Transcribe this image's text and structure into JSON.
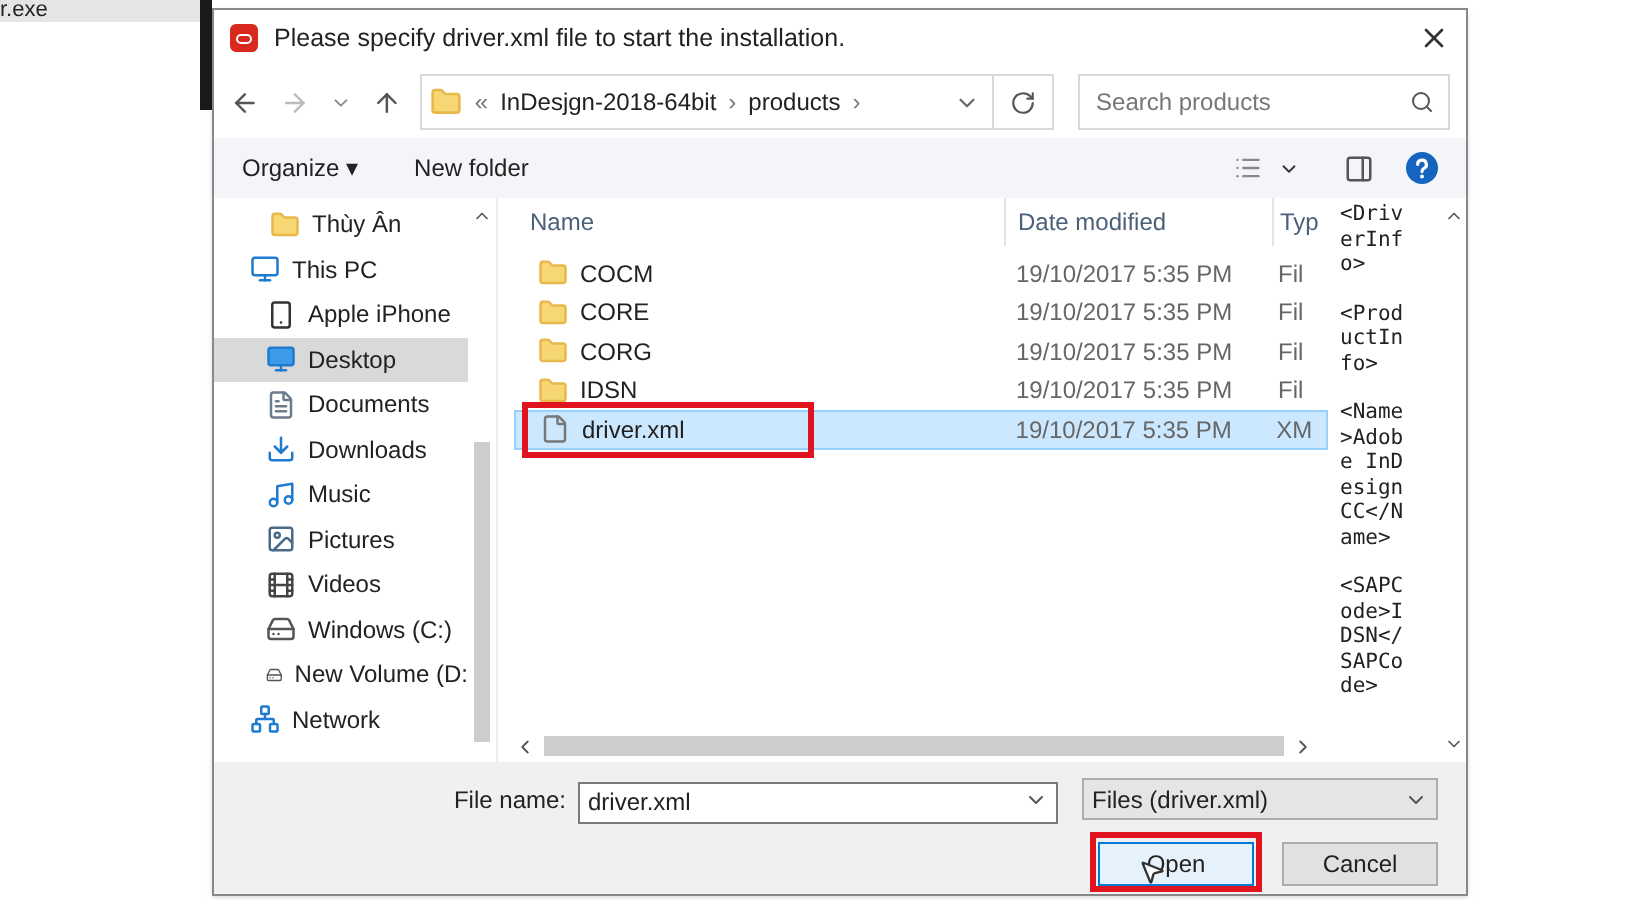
{
  "background": {
    "file_label": "r.exe"
  },
  "dialog": {
    "title": "Please specify driver.xml file to start the installation.",
    "path": [
      "«",
      "InDesjgn-2018-64bit",
      "›",
      "products",
      "›"
    ],
    "search": {
      "placeholder": "Search products"
    },
    "toolbar": [
      "Organize ▾",
      "New folder"
    ],
    "nav_pane": {
      "items": [
        {
          "label": "Thùy Ân",
          "kind": "folder",
          "selected": false
        },
        {
          "label": "This PC",
          "kind": "pc",
          "selected": false,
          "children": [
            {
              "label": "Apple iPhone",
              "kind": "phone",
              "selected": false
            },
            {
              "label": "Desktop",
              "kind": "desktop",
              "selected": true
            },
            {
              "label": "Documents",
              "kind": "documents",
              "selected": false
            },
            {
              "label": "Downloads",
              "kind": "downloads",
              "selected": false
            },
            {
              "label": "Music",
              "kind": "music",
              "selected": false
            },
            {
              "label": "Pictures",
              "kind": "pictures",
              "selected": false
            },
            {
              "label": "Videos",
              "kind": "videos",
              "selected": false
            },
            {
              "label": "Windows (C:)",
              "kind": "drive",
              "selected": false
            },
            {
              "label": "New Volume (D:",
              "kind": "drive",
              "selected": false
            }
          ]
        },
        {
          "label": "Network",
          "kind": "network",
          "selected": false
        }
      ]
    },
    "table": {
      "columns": [
        "Name",
        "Date modified",
        "Typ"
      ],
      "rows": [
        {
          "kind": "folder",
          "name": "COCM",
          "date": "19/10/2017 5:35 PM",
          "type": "Fil",
          "selected": false,
          "highlighted": false
        },
        {
          "kind": "folder",
          "name": "CORE",
          "date": "19/10/2017 5:35 PM",
          "type": "Fil",
          "selected": false,
          "highlighted": false
        },
        {
          "kind": "folder",
          "name": "CORG",
          "date": "19/10/2017 5:35 PM",
          "type": "Fil",
          "selected": false,
          "highlighted": false
        },
        {
          "kind": "folder",
          "name": "IDSN",
          "date": "19/10/2017 5:35 PM",
          "type": "Fil",
          "selected": false,
          "highlighted": false
        },
        {
          "kind": "file",
          "name": "driver.xml",
          "date": "19/10/2017 5:35 PM",
          "type": "XM",
          "selected": true,
          "highlighted": true
        }
      ]
    },
    "preview": [
      "<DriverInfo>",
      "<ProductInfo>",
      "<Name>Adobe InDesign CC</Name>",
      "<SAPCode>IDSN</SAPCode>"
    ],
    "file_name": {
      "label": "File name:",
      "value": "driver.xml"
    },
    "file_type": "Files (driver.xml)",
    "buttons": [
      {
        "label": "Open",
        "kind": "primary",
        "highlighted": true
      },
      {
        "label": "Cancel",
        "kind": "secondary",
        "highlighted": false
      }
    ]
  }
}
